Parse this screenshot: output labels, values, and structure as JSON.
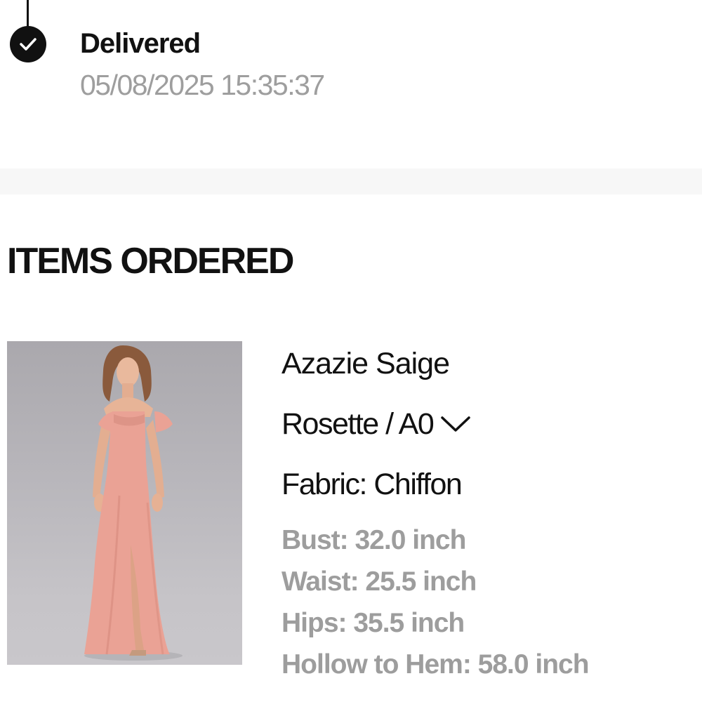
{
  "delivery": {
    "status": "Delivered",
    "timestamp": "05/08/2025 15:35:37",
    "icon": "check-circle-icon"
  },
  "items_section": {
    "title": "ITEMS ORDERED"
  },
  "item": {
    "name": "Azazie Saige",
    "variant": "Rosette / A0",
    "variant_icon": "chevron-down-icon",
    "fabric": "Fabric: Chiffon",
    "measurements": [
      "Bust: 32.0 inch",
      "Waist: 25.5 inch",
      "Hips: 35.5 inch",
      "Hollow to Hem: 58.0 inch"
    ]
  },
  "colors": {
    "text": "#111111",
    "muted": "#9d9d9d",
    "divider": "#f7f7f7",
    "dress": "#eaa295"
  }
}
